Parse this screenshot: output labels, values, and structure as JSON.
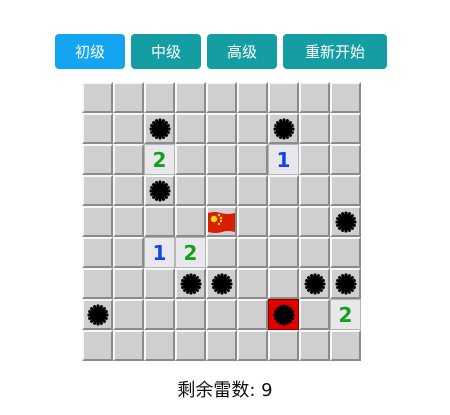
{
  "colors": {
    "active_button": "#13a5f2",
    "button": "#149ea4",
    "num_1": "#1446e6",
    "num_2": "#14a01e",
    "exploded": "#e00000"
  },
  "toolbar": {
    "buttons": [
      {
        "label": "初级",
        "active": true
      },
      {
        "label": "中级",
        "active": false
      },
      {
        "label": "高级",
        "active": false
      },
      {
        "label": "重新开始",
        "active": false
      }
    ]
  },
  "board": {
    "rows": 9,
    "cols": 9,
    "grid": [
      [
        "h",
        "h",
        "h",
        "h",
        "h",
        "h",
        "h",
        "h",
        "h"
      ],
      [
        "h",
        "h",
        "m",
        "h",
        "h",
        "h",
        "m",
        "h",
        "h"
      ],
      [
        "h",
        "h",
        "2",
        "h",
        "h",
        "h",
        "1",
        "h",
        "h"
      ],
      [
        "h",
        "h",
        "m",
        "h",
        "h",
        "h",
        "h",
        "h",
        "h"
      ],
      [
        "h",
        "h",
        "h",
        "h",
        "f",
        "h",
        "h",
        "h",
        "m"
      ],
      [
        "h",
        "h",
        "1",
        "2",
        "h",
        "h",
        "h",
        "h",
        "h"
      ],
      [
        "h",
        "h",
        "h",
        "m",
        "m",
        "h",
        "h",
        "m",
        "m"
      ],
      [
        "m",
        "h",
        "h",
        "h",
        "h",
        "h",
        "x",
        "h",
        "2"
      ],
      [
        "h",
        "h",
        "h",
        "h",
        "h",
        "h",
        "h",
        "h",
        "h"
      ]
    ]
  },
  "status": {
    "label": "剩余雷数:",
    "value": "9"
  }
}
